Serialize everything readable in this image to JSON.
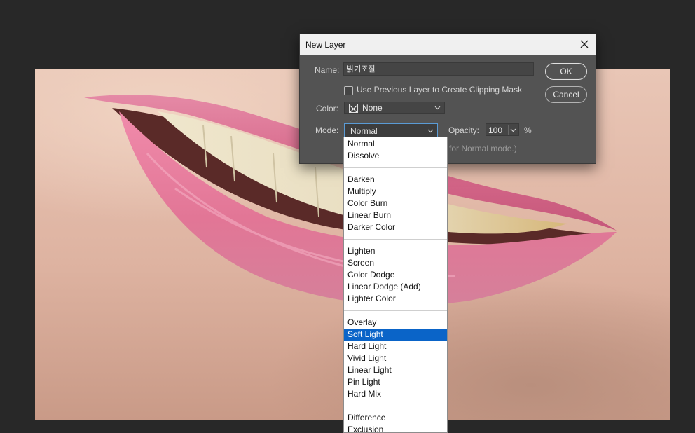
{
  "dialog": {
    "title": "New Layer",
    "name_label": "Name:",
    "name_value": "밝기조절",
    "checkbox_label": "Use Previous Layer to Create Clipping Mask",
    "color_label": "Color:",
    "color_value": "None",
    "mode_label": "Mode:",
    "mode_value": "Normal",
    "opacity_label": "Opacity:",
    "opacity_value": "100",
    "opacity_unit": "%",
    "note": "for Normal mode.)",
    "ok_label": "OK",
    "cancel_label": "Cancel"
  },
  "mode_dropdown": {
    "groups": [
      [
        "Normal",
        "Dissolve"
      ],
      [
        "Darken",
        "Multiply",
        "Color Burn",
        "Linear Burn",
        "Darker Color"
      ],
      [
        "Lighten",
        "Screen",
        "Color Dodge",
        "Linear Dodge (Add)",
        "Lighter Color"
      ],
      [
        "Overlay",
        "Soft Light",
        "Hard Light",
        "Vivid Light",
        "Linear Light",
        "Pin Light",
        "Hard Mix"
      ],
      [
        "Difference",
        "Exclusion"
      ]
    ],
    "highlighted": "Soft Light",
    "highlight_color": "#0a64c8"
  },
  "icons": {
    "close": "close-icon",
    "color_swatch": "x-swatch-icon",
    "chevron": "chevron-down-icon"
  }
}
